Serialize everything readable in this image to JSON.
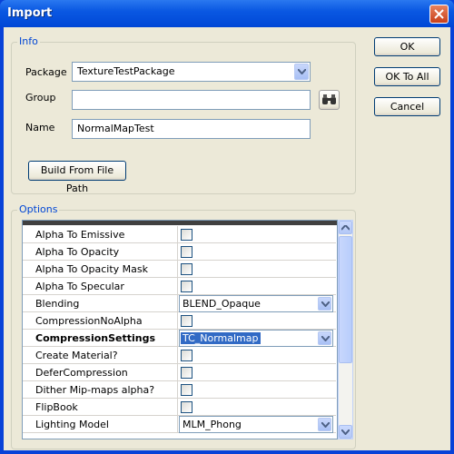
{
  "window": {
    "title": "Import"
  },
  "info": {
    "legend": "Info",
    "package_label": "Package",
    "package_value": "TextureTestPackage",
    "group_label": "Group",
    "group_value": "",
    "name_label": "Name",
    "name_value": "NormalMapTest",
    "build_button": "Build From File Path"
  },
  "buttons": {
    "ok": "OK",
    "ok_to_all": "OK To All",
    "cancel": "Cancel"
  },
  "options": {
    "legend": "Options",
    "rows": [
      {
        "name": "Alpha To Emissive",
        "type": "checkbox",
        "checked": false
      },
      {
        "name": "Alpha To Opacity",
        "type": "checkbox",
        "checked": false
      },
      {
        "name": "Alpha To Opacity Mask",
        "type": "checkbox",
        "checked": false
      },
      {
        "name": "Alpha To Specular",
        "type": "checkbox",
        "checked": false
      },
      {
        "name": "Blending",
        "type": "combo",
        "value": "BLEND_Opaque"
      },
      {
        "name": "CompressionNoAlpha",
        "type": "checkbox",
        "checked": false
      },
      {
        "name": "CompressionSettings",
        "type": "combo",
        "value": "TC_Normalmap",
        "selected": true
      },
      {
        "name": "Create Material?",
        "type": "checkbox",
        "checked": false
      },
      {
        "name": "DeferCompression",
        "type": "checkbox",
        "checked": false
      },
      {
        "name": "Dither Mip-maps alpha?",
        "type": "checkbox",
        "checked": false
      },
      {
        "name": "FlipBook",
        "type": "checkbox",
        "checked": false
      },
      {
        "name": "Lighting Model",
        "type": "combo",
        "value": "MLM_Phong"
      }
    ]
  },
  "colors": {
    "title_bar": "#0a58e2",
    "legend": "#0046d5",
    "selection": "#316ac5"
  }
}
